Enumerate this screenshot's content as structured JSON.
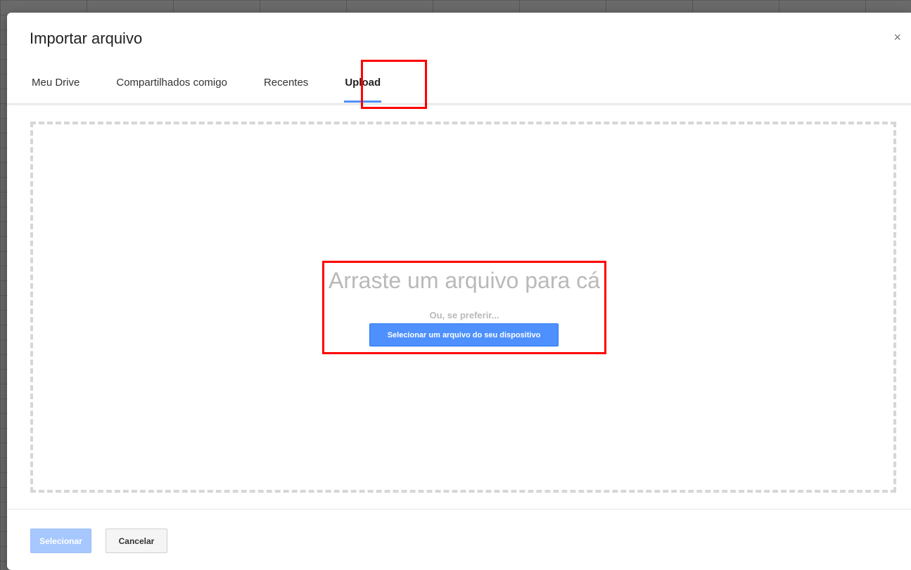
{
  "dialog": {
    "title": "Importar arquivo",
    "close_glyph": "×"
  },
  "tabs": [
    {
      "label": "Meu Drive",
      "active": false
    },
    {
      "label": "Compartilhados comigo",
      "active": false
    },
    {
      "label": "Recentes",
      "active": false
    },
    {
      "label": "Upload",
      "active": true
    }
  ],
  "upload": {
    "drop_title": "Arraste um arquivo para cá",
    "drop_subtitle": "Ou, se preferir...",
    "select_button": "Selecionar um arquivo do seu dispositivo"
  },
  "footer": {
    "select_label": "Selecionar",
    "select_enabled": false,
    "cancel_label": "Cancelar"
  },
  "colors": {
    "accent": "#4d90fe",
    "highlight": "#ff0000",
    "muted_text": "#b9b9b9"
  },
  "icons": {
    "close": "close-icon"
  }
}
